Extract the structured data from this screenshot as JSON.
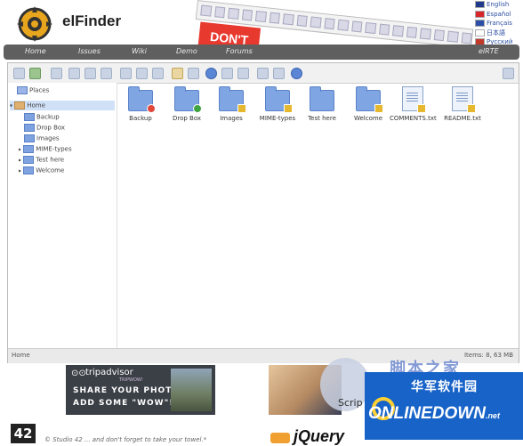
{
  "header": {
    "app_title": "elFinder",
    "promo_text": "DON'T"
  },
  "languages": [
    {
      "label": "English",
      "flag_color": "#1f3a8a"
    },
    {
      "label": "Español",
      "flag_color": "#d8262d"
    },
    {
      "label": "Français",
      "flag_color": "#2c4fa8"
    },
    {
      "label": "日本語",
      "flag_color": "#ffffff"
    },
    {
      "label": "Русский",
      "flag_color": "#c0392b"
    }
  ],
  "nav": {
    "items": [
      "Home",
      "Issues",
      "Wiki",
      "Demo",
      "Forums"
    ],
    "right_label": "elRTE"
  },
  "finder": {
    "places_label": "Places",
    "tree": {
      "root": "Home",
      "children": [
        "Backup",
        "Drop Box",
        "Images",
        "MIME-types",
        "Test here",
        "Welcome"
      ]
    },
    "items": [
      {
        "label": "Backup",
        "kind": "folder",
        "badge_color": "#e0463a"
      },
      {
        "label": "Drop Box",
        "kind": "folder",
        "badge_color": "#3fa33f"
      },
      {
        "label": "Images",
        "kind": "folder",
        "badge_color": "#e6b830"
      },
      {
        "label": "MIME-types",
        "kind": "folder",
        "badge_color": "#e6b830"
      },
      {
        "label": "Test here",
        "kind": "folder",
        "badge_color": ""
      },
      {
        "label": "Welcome",
        "kind": "folder",
        "badge_color": "#e6b830"
      },
      {
        "label": "COMMENTS.txt",
        "kind": "file",
        "badge_color": "#e6b830"
      },
      {
        "label": "README.txt",
        "kind": "file",
        "badge_color": "#e6b830"
      }
    ],
    "status_left": "Home",
    "status_right": "Items: 8, 63 MB"
  },
  "ads": {
    "tripadvisor_brand": "tripadvisor",
    "tripadvisor_sub": "TRIPWOW!",
    "line1": "SHARE YOUR PHOTOS",
    "line2": "ADD SOME \"WOW\"!"
  },
  "footer": {
    "badge": "42",
    "credits": "© Studio 42 ... and don't forget to take your towel.*",
    "jquery": "jQuery",
    "script_text": "Scrip",
    "watermark_cn": "脚本之家",
    "onlinedown_cn": "华军软件园",
    "onlinedown_en": "ONLINEDOWN",
    "onlinedown_suffix": ".net"
  },
  "colors": {
    "navbar": "#5f5f5f",
    "folder": "#7fa6e2",
    "selection": "#cfe0f7",
    "promo": "#e8392f",
    "onlinedown": "#1763c8"
  }
}
